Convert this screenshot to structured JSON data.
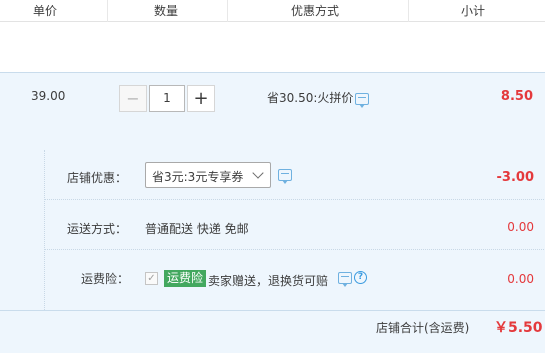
{
  "header": {
    "col_price": "单价",
    "col_qty": "数量",
    "col_promo": "优惠方式",
    "col_subtotal": "小计"
  },
  "item": {
    "price": "39.00",
    "quantity": "1",
    "minus_symbol": "−",
    "plus_symbol": "+",
    "promo_text": "省30.50:火拼价",
    "subtotal": "8.50"
  },
  "shop": {
    "coupon_label": "店铺优惠：",
    "coupon_selected": "省3元:3元专享券",
    "coupon_amount": "-3.00",
    "shipping_label": "运送方式：",
    "shipping_value": "普通配送 快递 免邮",
    "shipping_amount": "0.00",
    "insurance_label": "运费险：",
    "insurance_badge": "运费险",
    "insurance_text": "卖家赠送，退换货可赔",
    "insurance_amount": "0.00",
    "check_mark": "✓",
    "help_mark": "?"
  },
  "total": {
    "label": "店铺合计(含运费)",
    "value": "￥5.50"
  },
  "colors": {
    "accent_red": "#e4393c",
    "row_bg": "#eef6fd",
    "badge_green": "#43a85f",
    "icon_blue": "#3a9be0"
  },
  "icons": {
    "message": "message-bubble-icon",
    "help": "question-circle-icon",
    "dropdown": "chevron-down-icon"
  }
}
